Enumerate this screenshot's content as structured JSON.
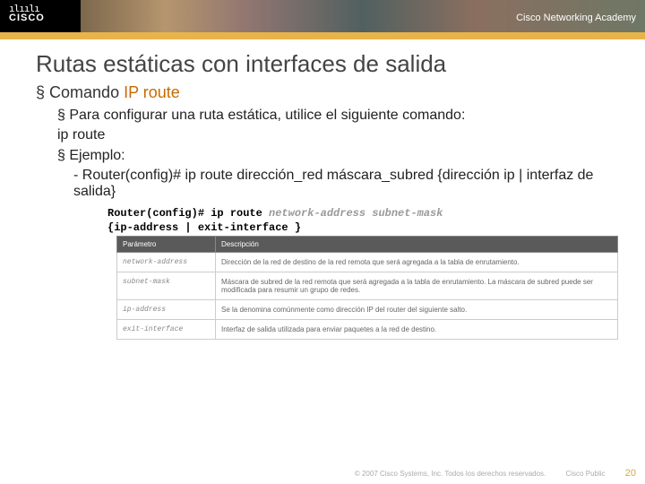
{
  "header": {
    "logo_bars": "ılıılı",
    "logo_text": "CISCO",
    "academy": "Cisco Networking Academy"
  },
  "title": "Rutas estáticas con interfaces de salida",
  "section": {
    "bullet": "§",
    "prefix": "Comando ",
    "highlight": "IP route"
  },
  "body": {
    "line1_bullet": "§",
    "line1": " Para configurar una ruta estática, utilice el siguiente comando:",
    "line1b": "ip route",
    "line2_bullet": "§",
    "line2": " Ejemplo:",
    "cmd": "- Router(config)# ip route dirección_red máscara_subred {dirección ip | interfaz de salida}"
  },
  "code": {
    "l1a": "Router(config)# ip route ",
    "l1b": "network-address  subnet-mask",
    "l2": "{ip-address | exit-interface }"
  },
  "table": {
    "h1": "Parámetro",
    "h2": "Descripción",
    "rows": [
      {
        "p": "network-address",
        "d": "Dirección de la red de destino de la red remota que será agregada a la tabla de enrutamiento."
      },
      {
        "p": "subnet-mask",
        "d": "Máscara de subred de la red remota que será agregada a la tabla de enrutamiento. La máscara de subred puede ser modificada para resumir un grupo de redes."
      },
      {
        "p": "ip-address",
        "d": "Se la denomina comúnmente como dirección IP del router del siguiente salto."
      },
      {
        "p": "exit-interface",
        "d": "Interfaz de salida utilizada para enviar paquetes a la red de destino."
      }
    ]
  },
  "footer": {
    "copy": "© 2007 Cisco Systems, Inc. Todos los derechos reservados.",
    "pub": "Cisco Public",
    "page": "20"
  }
}
